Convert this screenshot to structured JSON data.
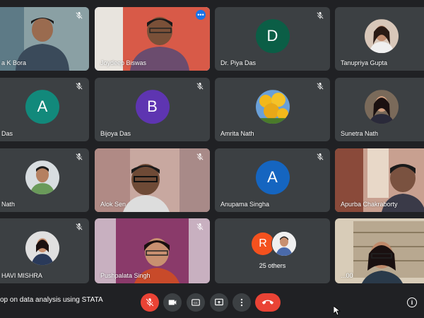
{
  "participants": [
    {
      "name": "a K Bora",
      "type": "video"
    },
    {
      "name": "Joydeep Biswas",
      "type": "video",
      "active": true
    },
    {
      "name": "Dr. Piya Das",
      "type": "initial",
      "initial": "D",
      "color": "#0b5e46"
    },
    {
      "name": "Tanupriya Gupta",
      "type": "photo"
    },
    {
      "name": "Das",
      "type": "initial",
      "initial": "A",
      "color": "#12897b"
    },
    {
      "name": "Bijoya Das",
      "type": "initial",
      "initial": "B",
      "color": "#5e35b1"
    },
    {
      "name": "Amrita Nath",
      "type": "photo"
    },
    {
      "name": "Sunetra Nath",
      "type": "photo"
    },
    {
      "name": "Nath",
      "type": "photo"
    },
    {
      "name": "Alok Sen",
      "type": "video"
    },
    {
      "name": "Anupama Singha",
      "type": "initial",
      "initial": "A",
      "color": "#1565c0"
    },
    {
      "name": "Apurba Chakraborty",
      "type": "video"
    },
    {
      "name": "HAVI MISHRA",
      "type": "photo"
    },
    {
      "name": "Pushpalata Singh",
      "type": "video"
    },
    {
      "name": "",
      "type": "others"
    },
    {
      "name": "...00",
      "type": "video"
    }
  ],
  "others": {
    "initial": "R",
    "label": "25 others",
    "color": "#f4511e"
  },
  "meeting_title": "op on data analysis using STATA",
  "controls": {
    "mic_icon": "mic-off-icon",
    "camera_icon": "videocam-icon",
    "captions_icon": "closed-captions-icon",
    "present_icon": "present-screen-icon",
    "more_icon": "more-vert-icon",
    "end_icon": "call-end-icon",
    "info_label": "i"
  }
}
